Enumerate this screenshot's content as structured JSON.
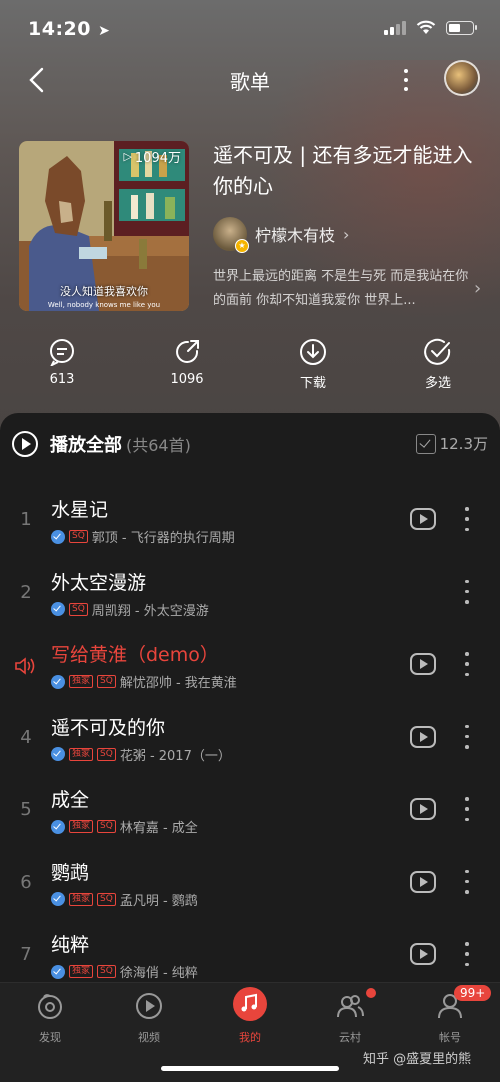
{
  "status_bar": {
    "time": "14:20"
  },
  "nav": {
    "title": "歌单"
  },
  "playlist": {
    "play_count": "1094万",
    "cover_caption": "没人知道我喜欢你",
    "cover_caption_en": "Well, nobody knows me like you",
    "title": "遥不可及 | 还有多远才能进入你的心",
    "creator": "柠檬木有枝",
    "description": "世界上最远的距离 不是生与死 而是我站在你的面前 你却不知道我爱你 世界上..."
  },
  "actions": {
    "comment": "613",
    "share": "1096",
    "download": "下载",
    "multi_select": "多选"
  },
  "list_header": {
    "play_all": "播放全部",
    "count": "(共64首)",
    "collect_count": "12.3万"
  },
  "songs": [
    {
      "index": "1",
      "name": "水星记",
      "tags": [
        "SQ"
      ],
      "meta": "郭顶 - 飞行器的执行周期",
      "mv": true
    },
    {
      "index": "2",
      "name": "外太空漫游",
      "tags": [
        "SQ"
      ],
      "meta": "周凯翔 - 外太空漫游",
      "mv": false
    },
    {
      "index": "",
      "name": "写给黄淮（demo）",
      "tags": [
        "独家",
        "SQ"
      ],
      "meta": "解忧邵帅 - 我在黄淮",
      "mv": true,
      "playing": true
    },
    {
      "index": "4",
      "name": "遥不可及的你",
      "tags": [
        "独家",
        "SQ"
      ],
      "meta": "花粥 - 2017（一）",
      "mv": true
    },
    {
      "index": "5",
      "name": "成全",
      "tags": [
        "独家",
        "SQ"
      ],
      "meta": "林宥嘉 - 成全",
      "mv": true
    },
    {
      "index": "6",
      "name": "鹦鹉",
      "tags": [
        "独家",
        "SQ"
      ],
      "meta": "孟凡明 - 鹦鹉",
      "mv": true
    },
    {
      "index": "7",
      "name": "纯粹",
      "tags": [
        "独家",
        "SQ"
      ],
      "meta": "徐海俏 - 纯粹",
      "mv": true
    }
  ],
  "tabbar": {
    "discover": "发现",
    "video": "视频",
    "mine": "我的",
    "village": "云村",
    "account": "帐号",
    "account_badge": "99+"
  },
  "watermark": "知乎 @盛夏里的熊",
  "colors": {
    "accent": "#e8453c",
    "verified": "#4a90e2"
  }
}
